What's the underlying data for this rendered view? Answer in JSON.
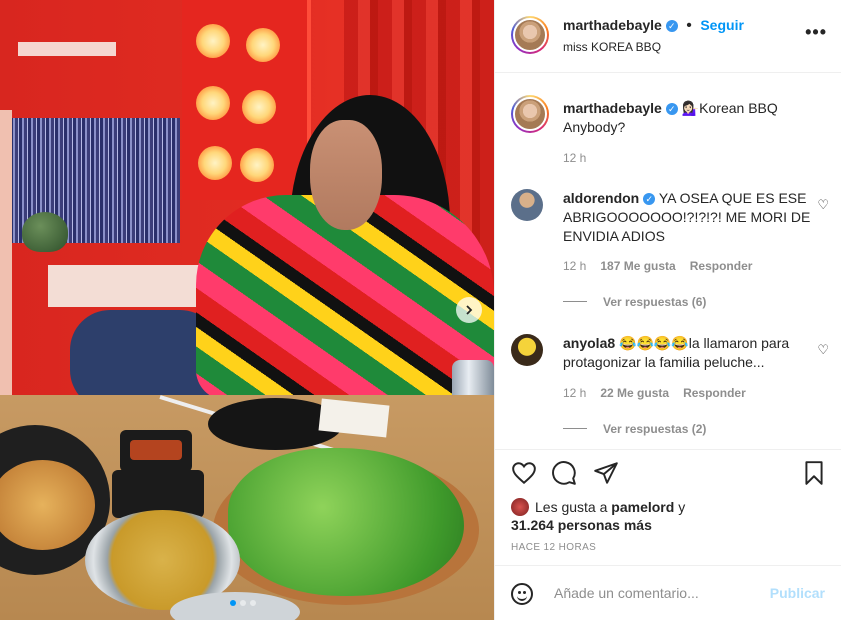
{
  "post": {
    "author": "marthadebayle",
    "follow_label": "Seguir",
    "separator": "•",
    "location": "miss KOREA BBQ",
    "more_label": "•••"
  },
  "caption": {
    "username": "marthadebayle",
    "emoji": "💁🏻‍♀️",
    "text": "Korean BBQ Anybody?",
    "time": "12 h"
  },
  "comments": [
    {
      "username": "aldorendon",
      "verified": true,
      "text": "YA OSEA QUE ES ESE ABRIGOOOOOOO!?!?!?! ME MORI DE ENVIDIA ADIOS",
      "time": "12 h",
      "likes": "187 Me gusta",
      "reply": "Responder",
      "view_replies": "Ver respuestas (6)"
    },
    {
      "username": "anyola8",
      "verified": false,
      "emoji": "😂😂😂😂",
      "text": "la llamaron para protagonizar la familia peluche...",
      "time": "12 h",
      "likes": "22 Me gusta",
      "reply": "Responder",
      "view_replies": "Ver respuestas (2)"
    }
  ],
  "likes": {
    "prefix": "Les gusta a",
    "user": "pamelord",
    "connector": "y",
    "count": "31.264 personas más"
  },
  "timestamp": "HACE 12 HORAS",
  "add_comment": {
    "placeholder": "Añade un comentario...",
    "publish": "Publicar"
  },
  "icons": [
    "heart-icon",
    "comment-icon",
    "share-icon",
    "bookmark-icon",
    "emoji-icon",
    "verified-icon",
    "chevron-right-icon"
  ],
  "colors": {
    "accent": "#0095f6",
    "publish_disabled": "#b2dffc",
    "muted": "#8e8e8e",
    "text": "#262626"
  },
  "carousel": {
    "current": 1,
    "total": 3
  }
}
